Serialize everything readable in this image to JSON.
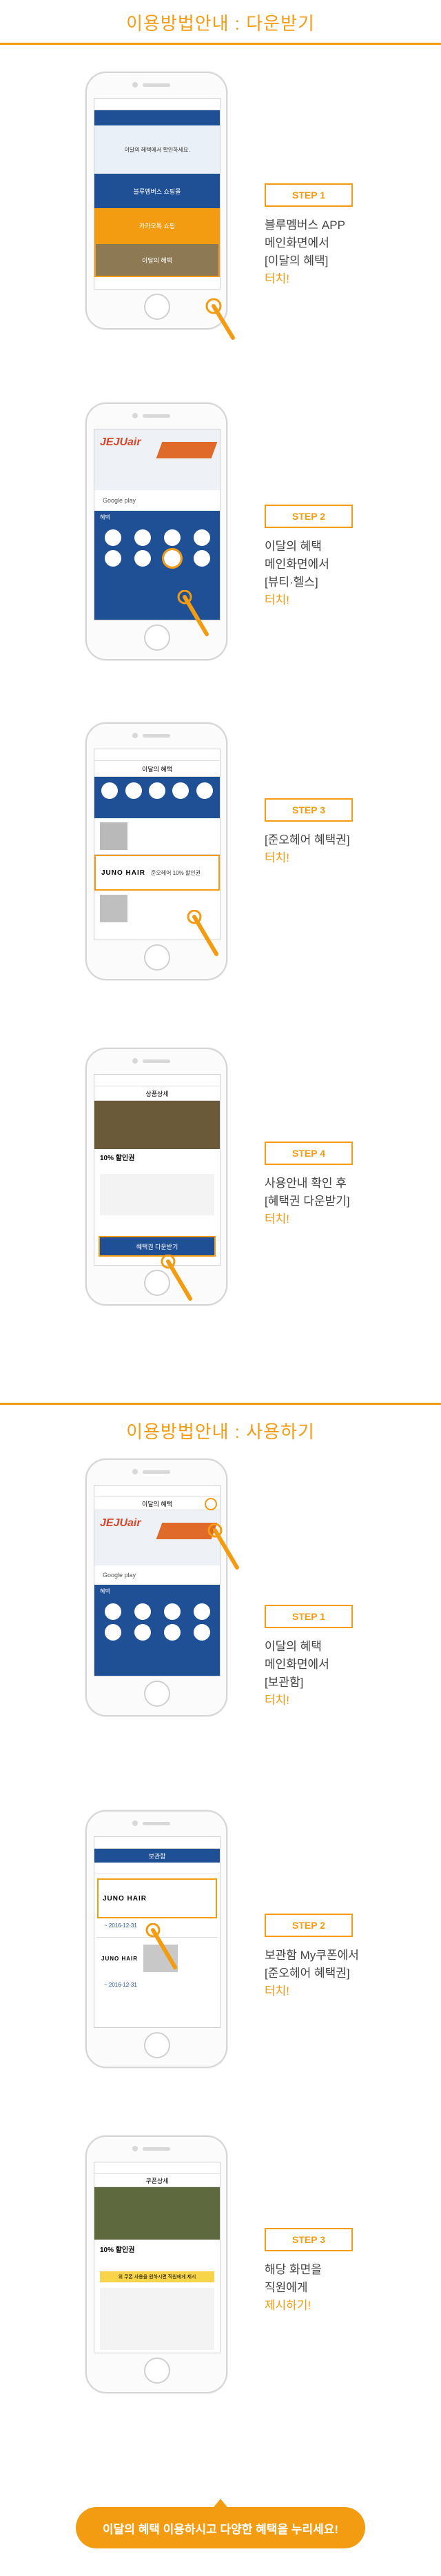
{
  "sections": [
    {
      "title": "이용방법안내 : 다운받기"
    },
    {
      "title": "이용방법안내 : 사용하기"
    }
  ],
  "download_steps": [
    {
      "badge": "STEP 1",
      "lines": [
        "블루멤버스 APP",
        "메인화면에서",
        "[이달의 혜택]"
      ],
      "accent": "터치!"
    },
    {
      "badge": "STEP 2",
      "lines": [
        "이달의 혜택",
        "메인화면에서",
        "[뷰티·헬스]"
      ],
      "accent": "터치!"
    },
    {
      "badge": "STEP 3",
      "lines": [
        "[준오헤어 혜택권]"
      ],
      "accent": "터치!"
    },
    {
      "badge": "STEP 4",
      "lines": [
        "사용안내 확인 후",
        "[혜택권 다운받기]"
      ],
      "accent": "터치!"
    }
  ],
  "use_steps": [
    {
      "badge": "STEP 1",
      "lines": [
        "이달의 혜택",
        "메인화면에서",
        "[보관함]"
      ],
      "accent": "터치!"
    },
    {
      "badge": "STEP 2",
      "lines": [
        "보관함 My쿠폰에서",
        "[준오헤어 혜택권]"
      ],
      "accent": "터치!"
    },
    {
      "badge": "STEP 3",
      "lines": [
        "해당 화면을",
        "직원에게"
      ],
      "accent": "제시하기!"
    }
  ],
  "screens": {
    "s1": {
      "menu_a": "이달의 혜택에서 확인하세요.",
      "row1": "블루멤버스 쇼핑몰",
      "row2": "카카오톡 쇼핑",
      "row3": "이달의 혜택"
    },
    "s2": {
      "banner": "JEJUair",
      "store": "Google play",
      "cat": "혜택"
    },
    "s3": {
      "title": "이달의 혜택",
      "brand": "JUNO HAIR",
      "offer": "준오헤어 10% 할인권"
    },
    "s4": {
      "title": "상품상세",
      "price": "10% 할인권",
      "button": "혜택권 다운받기"
    },
    "u1": {
      "title": "이달의 혜택",
      "banner": "JEJUair",
      "store": "Google play",
      "cat": "혜택"
    },
    "u2": {
      "title": "보관함",
      "brand": "JUNO HAIR",
      "date1": "~ 2016-12-31",
      "brand2": "JUNO HAIR",
      "date2": "~ 2016-12-31"
    },
    "u3": {
      "title": "쿠폰상세",
      "offer": "10% 할인권",
      "button": "위 쿠폰 사용을 원하시면 직원에게 제시"
    }
  },
  "final_message": "이달의 혜택 이용하시고 다양한 혜택을 누리세요!",
  "colors": {
    "accent": "#f39c12",
    "primary": "#1f4f95"
  }
}
